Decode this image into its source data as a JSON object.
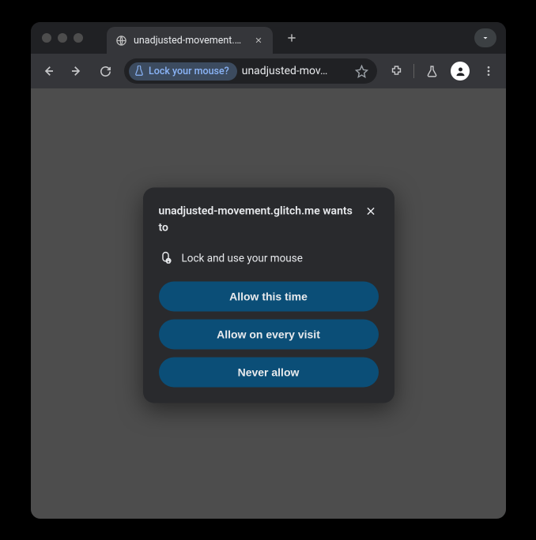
{
  "tab": {
    "title": "unadjusted-movement.glitch."
  },
  "omnibox": {
    "chip_text": "Lock your mouse?",
    "url_display": "unadjusted-mov…"
  },
  "dialog": {
    "title": "unadjusted-movement.glitch.me wants to",
    "permission_label": "Lock and use your mouse",
    "buttons": {
      "allow_once": "Allow this time",
      "allow_always": "Allow on every visit",
      "never": "Never allow"
    }
  }
}
